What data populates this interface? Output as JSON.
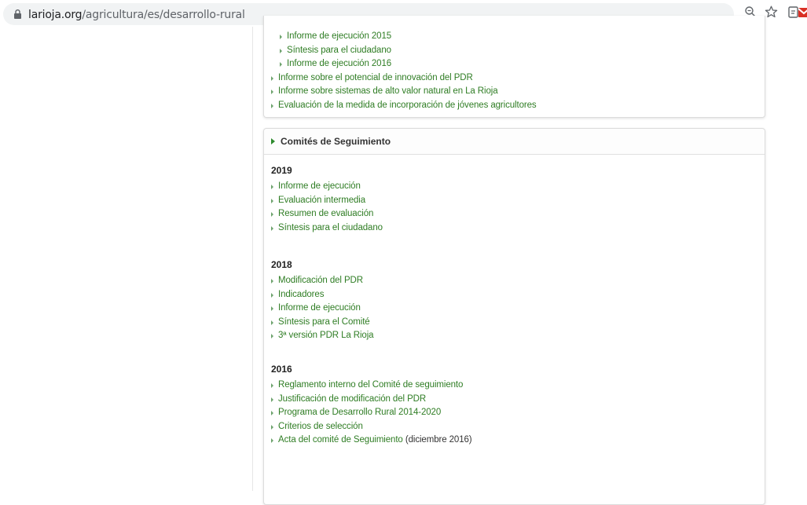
{
  "browser": {
    "url_host": "larioja.org",
    "url_path": "/agricultura/es/desarrollo-rural",
    "icons": [
      "lock-icon",
      "zoom-icon",
      "star-icon",
      "extension-icon",
      "gmail-icon"
    ]
  },
  "top_panel": {
    "items": [
      {
        "label": "Informe de ejecución 2015",
        "sub": true
      },
      {
        "label": "Síntesis para el ciudadano",
        "sub": true
      },
      {
        "label": "Informe de ejecución 2016",
        "sub": true
      },
      {
        "label": "Informe sobre el potencial de innovación del PDR",
        "sub": false
      },
      {
        "label": "Informe sobre sistemas de alto valor natural en La Rioja",
        "sub": false
      },
      {
        "label": "Evaluación de la medida de incorporación de jóvenes agricultores",
        "sub": false
      }
    ]
  },
  "committees": {
    "title": "Comités de Seguimiento",
    "years": [
      {
        "year": "2019",
        "items": [
          "Informe de ejecución",
          "Evaluación intermedia",
          "Resumen de evaluación",
          "Síntesis para el ciudadano"
        ]
      },
      {
        "year": "2018",
        "items": [
          "Modificación del PDR",
          "Indicadores",
          "Informe de ejecución",
          "Síntesis para el Comité",
          "3ª versión PDR La Rioja"
        ]
      },
      {
        "year": "2016",
        "items": [
          "Reglamento interno del Comité de seguimiento",
          "Justificación de modificación del PDR",
          "Programa de Desarrollo Rural 2014-2020",
          "Criterios de selección",
          "Acta del comité de Seguimiento"
        ],
        "last_note": "(diciembre 2016)"
      }
    ]
  },
  "colors": {
    "link": "#2f7d24",
    "accent": "#2e8b2e"
  }
}
